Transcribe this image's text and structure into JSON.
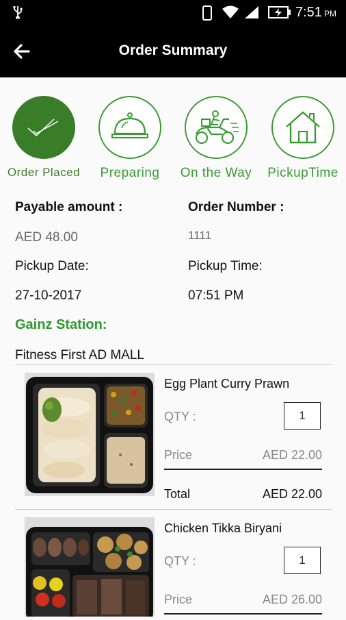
{
  "status_bar": {
    "usb_icon": "usb-icon",
    "time": "7:51",
    "ampm": "PM"
  },
  "header": {
    "title": "Order Summary",
    "back_icon": "arrow-left-icon"
  },
  "steps": [
    {
      "label": "Order Placed",
      "icon": "check-icon",
      "active": true
    },
    {
      "label": "Preparing",
      "icon": "cloche-icon",
      "active": false
    },
    {
      "label": "On the Way",
      "icon": "scooter-icon",
      "active": false
    },
    {
      "label": "PickupTime",
      "icon": "house-icon",
      "active": false
    }
  ],
  "summary": {
    "payable_label": "Payable amount :",
    "payable_value": "AED 48.00",
    "order_number_label": "Order Number :",
    "order_number_value": "1111",
    "pickup_date_label": "Pickup Date:",
    "pickup_date_value": "27-10-2017",
    "pickup_time_label": "Pickup Time:",
    "pickup_time_value": "07:51 PM",
    "station_label": "Gainz Station:",
    "station_value": "Fitness First AD MALL"
  },
  "items": [
    {
      "name": "Egg Plant Curry Prawn",
      "qty_label": "QTY :",
      "qty": "1",
      "price_label": "Price",
      "price": "AED 22.00",
      "total_label": "Total",
      "total": "AED 22.00"
    },
    {
      "name": "Chicken Tikka Biryani",
      "qty_label": "QTY :",
      "qty": "1",
      "price_label": "Price",
      "price": "AED 26.00"
    }
  ],
  "colors": {
    "accent_green": "#3a9b33",
    "active_green": "#3a7d28",
    "bar_black": "#000000"
  }
}
